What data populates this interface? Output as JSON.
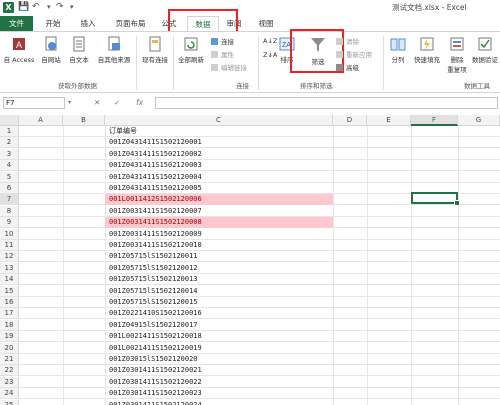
{
  "window": {
    "title": "测试文档.xlsx - Excel",
    "app_icon": "X"
  },
  "quick_access": {
    "save_icon": "💾",
    "undo_icon": "↶",
    "redo_icon": "↷"
  },
  "tabs": [
    "文件",
    "开始",
    "插入",
    "页面布局",
    "公式",
    "数据",
    "审阅",
    "视图"
  ],
  "ribbon": {
    "get_external": {
      "access": "自 Access",
      "web": "自网站",
      "text": "自文本",
      "other": "自其他来源",
      "existing": "现有连接",
      "group": "获取外部数据"
    },
    "connections": {
      "refresh_all": "全部刷新",
      "connections": "连接",
      "properties": "属性",
      "edit_links": "编辑链接",
      "group": "连接"
    },
    "sort_filter": {
      "az": "A↓Z",
      "za": "Z↓A",
      "sort": "排序",
      "filter": "筛选",
      "clear": "清除",
      "reapply": "重新应用",
      "advanced": "高级",
      "group": "排序和筛选"
    },
    "data_tools": {
      "split": "分列",
      "flash_fill": "快速填充",
      "remove_dup_1": "删除",
      "remove_dup_2": "重复项",
      "validation": "数据验证",
      "group": "数据工具"
    }
  },
  "formula_bar": {
    "name_box": "F7",
    "cancel": "✕",
    "enter": "✓",
    "fx": "fx",
    "formula": ""
  },
  "columns": [
    "A",
    "B",
    "C",
    "D",
    "E",
    "F",
    "G"
  ],
  "rows": [
    "1",
    "2",
    "3",
    "4",
    "5",
    "6",
    "7",
    "8",
    "9",
    "10",
    "11",
    "12",
    "13",
    "14",
    "15",
    "16",
    "17",
    "18",
    "19",
    "20",
    "21",
    "22",
    "23",
    "24",
    "25"
  ],
  "cells_c": [
    "订单编号",
    "001Z0431411S1502120001",
    "001Z0431411S1502120002",
    "001Z0431411S1502120003",
    "001Z0431411S1502120004",
    "001Z0431411S1502120005",
    "001L0011412S1502120006",
    "001Z0031411S1502120007",
    "001Z0031411S1502120008",
    "001Z0031411S1502120009",
    "001Z0031411S1502120010",
    "001Z05715lS1502120011",
    "001Z05715lS1502120012",
    "001Z05715lS1502120013",
    "001Z05715lS1502120014",
    "001Z05715lS1502120015",
    "001Z0221410S1502120016",
    "001Z04915lS1502120017",
    "001L0021411S1502120018",
    "001L0021411S1502120019",
    "001Z03015lS1502120020",
    "001Z0301411S1502120021",
    "001Z0301411S1502120022",
    "001Z0301411S1502120023",
    "001Z0301411S1502120024"
  ],
  "highlight_color": "#ffc7ce",
  "highlight_text_color": "#9c0006",
  "accent_color": "#217346"
}
